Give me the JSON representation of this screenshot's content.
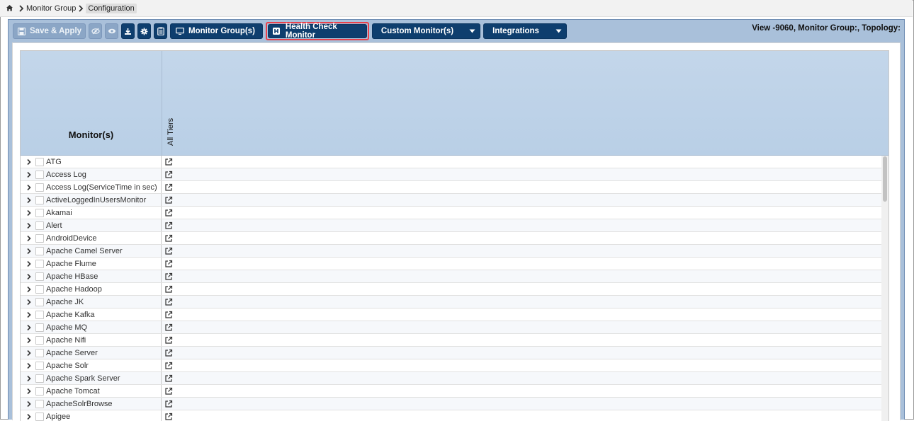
{
  "breadcrumb": {
    "home_icon": "home-icon",
    "items": [
      "Monitor Group",
      "Configuration"
    ]
  },
  "toolbar": {
    "save_label": "Save & Apply",
    "icons": [
      "hide-eye-icon",
      "eye-icon",
      "download-icon",
      "gear-icon",
      "clipboard-icon"
    ],
    "monitor_groups_label": "Monitor Group(s)",
    "health_check_label": "Health Check Monitor",
    "custom_monitors_label": "Custom Monitor(s)",
    "integrations_label": "Integrations",
    "highlight_color": "#e8404a"
  },
  "topology_info": "View -9060, Monitor Group:, Topology:",
  "grid": {
    "monitor_header": "Monitor(s)",
    "tier_header": "All Tiers",
    "rows": [
      "ATG",
      "Access Log",
      "Access Log(ServiceTime in sec)",
      "ActiveLoggedInUsersMonitor",
      "Akamai",
      "Alert",
      "AndroidDevice",
      "Apache Camel Server",
      "Apache Flume",
      "Apache HBase",
      "Apache Hadoop",
      "Apache JK",
      "Apache Kafka",
      "Apache MQ",
      "Apache Nifi",
      "Apache Server",
      "Apache Solr",
      "Apache Spark Server",
      "Apache Tomcat",
      "ApacheSolrBrowse",
      "Apigee"
    ]
  },
  "colors": {
    "toolbar_bg": "#a9c0da",
    "button_dark": "#0e3e6e",
    "header_bg": "#c3d6ea"
  }
}
